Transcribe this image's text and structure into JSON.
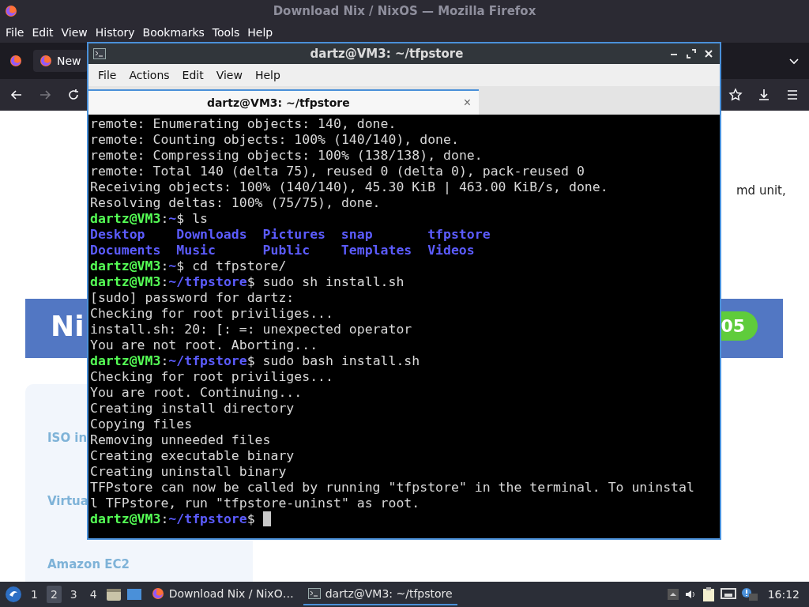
{
  "firefox": {
    "title": "Download Nix / NixOS — Mozilla Firefox",
    "menu": [
      "File",
      "Edit",
      "View",
      "History",
      "Bookmarks",
      "Tools",
      "Help"
    ],
    "tabs": [
      {
        "label": "New",
        "selected": true
      }
    ],
    "page": {
      "fragment_text": "md unit,",
      "banner_title": "Ni",
      "badge": "05",
      "links": [
        "ISO in",
        "Virtua",
        "Amazon EC2"
      ]
    }
  },
  "terminal": {
    "title": "dartz@VM3: ~/tfpstore",
    "menu": [
      "File",
      "Actions",
      "Edit",
      "View",
      "Help"
    ],
    "tabs": [
      {
        "label": "dartz@VM3: ~/tfpstore",
        "selected": true,
        "close": "×"
      }
    ],
    "lines": [
      {
        "kind": "output",
        "text": "remote: Enumerating objects: 140, done."
      },
      {
        "kind": "output",
        "text": "remote: Counting objects: 100% (140/140), done."
      },
      {
        "kind": "output",
        "text": "remote: Compressing objects: 100% (138/138), done."
      },
      {
        "kind": "output",
        "text": "remote: Total 140 (delta 75), reused 0 (delta 0), pack-reused 0"
      },
      {
        "kind": "output",
        "text": "Receiving objects: 100% (140/140), 45.30 KiB | 463.00 KiB/s, done."
      },
      {
        "kind": "output",
        "text": "Resolving deltas: 100% (75/75), done."
      },
      {
        "kind": "prompt",
        "user": "dartz@VM3",
        "sep": ":",
        "path": "~",
        "symbol": "$",
        "command": "ls",
        "cursor": false
      },
      {
        "kind": "listing",
        "items": [
          "Desktop",
          "Downloads",
          "Pictures",
          "snap",
          "tfpstore"
        ]
      },
      {
        "kind": "listing",
        "items": [
          "Documents",
          "Music",
          "Public",
          "Templates",
          "Videos"
        ]
      },
      {
        "kind": "prompt",
        "user": "dartz@VM3",
        "sep": ":",
        "path": "~",
        "symbol": "$",
        "command": "cd tfpstore/",
        "cursor": false
      },
      {
        "kind": "prompt",
        "user": "dartz@VM3",
        "sep": ":",
        "path": "~/tfpstore",
        "symbol": "$",
        "command": "sudo sh install.sh",
        "cursor": false
      },
      {
        "kind": "output",
        "text": "[sudo] password for dartz:"
      },
      {
        "kind": "output",
        "text": "Checking for root priviliges..."
      },
      {
        "kind": "output",
        "text": "install.sh: 20: [: =: unexpected operator"
      },
      {
        "kind": "output",
        "text": "You are not root. Aborting..."
      },
      {
        "kind": "prompt",
        "user": "dartz@VM3",
        "sep": ":",
        "path": "~/tfpstore",
        "symbol": "$",
        "command": "sudo bash install.sh",
        "cursor": false
      },
      {
        "kind": "output",
        "text": "Checking for root priviliges..."
      },
      {
        "kind": "output",
        "text": "You are root. Continuing..."
      },
      {
        "kind": "output",
        "text": "Creating install directory"
      },
      {
        "kind": "output",
        "text": "Copying files"
      },
      {
        "kind": "output",
        "text": "Removing unneeded files"
      },
      {
        "kind": "output",
        "text": "Creating executable binary"
      },
      {
        "kind": "output",
        "text": "Creating uninstall binary"
      },
      {
        "kind": "output",
        "text": "TFPstore can now be called by running \"tfpstore\" in the terminal. To uninstal"
      },
      {
        "kind": "output",
        "text": "l TFPstore, run \"tfpstore-uninst\" as root."
      },
      {
        "kind": "prompt",
        "user": "dartz@VM3",
        "sep": ":",
        "path": "~/tfpstore",
        "symbol": "$",
        "cursor": true
      }
    ]
  },
  "taskbar": {
    "workspaces": [
      {
        "label": "1",
        "selected": false
      },
      {
        "label": "2",
        "selected": true
      },
      {
        "label": "3",
        "selected": false
      },
      {
        "label": "4",
        "selected": false
      }
    ],
    "tasks": [
      {
        "kind": "browser",
        "label": "Download Nix / NixO…",
        "selected": false
      },
      {
        "kind": "terminal",
        "label": "dartz@VM3: ~/tfpstore",
        "selected": true
      }
    ],
    "clock": "16:12"
  }
}
